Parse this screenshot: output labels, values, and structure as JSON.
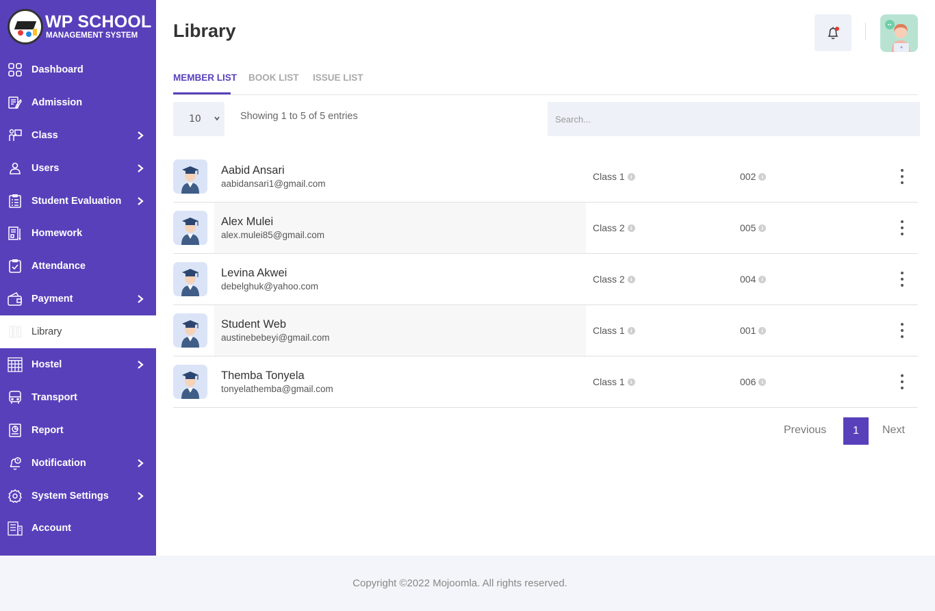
{
  "brand": {
    "title": "WP SCHOOL",
    "subtitle": "MANAGEMENT SYSTEM"
  },
  "sidebar": {
    "items": [
      {
        "label": "Dashboard",
        "icon": "dashboard-grid-icon",
        "has_submenu": false
      },
      {
        "label": "Admission",
        "icon": "admission-form-icon",
        "has_submenu": false
      },
      {
        "label": "Class",
        "icon": "class-teacher-icon",
        "has_submenu": true
      },
      {
        "label": "Users",
        "icon": "user-icon",
        "has_submenu": true
      },
      {
        "label": "Student Evaluation",
        "icon": "clipboard-checklist-icon",
        "has_submenu": true
      },
      {
        "label": "Homework",
        "icon": "homework-book-icon",
        "has_submenu": false
      },
      {
        "label": "Attendance",
        "icon": "attendance-check-icon",
        "has_submenu": false
      },
      {
        "label": "Payment",
        "icon": "wallet-icon",
        "has_submenu": true
      },
      {
        "label": "Library",
        "icon": "library-icon",
        "has_submenu": false,
        "active": true
      },
      {
        "label": "Hostel",
        "icon": "hostel-building-icon",
        "has_submenu": true
      },
      {
        "label": "Transport",
        "icon": "bus-icon",
        "has_submenu": false
      },
      {
        "label": "Report",
        "icon": "report-icon",
        "has_submenu": false
      },
      {
        "label": "Notification",
        "icon": "notification-bell-icon",
        "has_submenu": true
      },
      {
        "label": "System Settings",
        "icon": "gear-icon",
        "has_submenu": true
      },
      {
        "label": "Account",
        "icon": "account-building-icon",
        "has_submenu": false
      }
    ]
  },
  "header": {
    "title": "Library"
  },
  "tabs": [
    {
      "label": "MEMBER LIST",
      "active": true
    },
    {
      "label": "BOOK LIST",
      "active": false
    },
    {
      "label": "ISSUE LIST",
      "active": false
    }
  ],
  "controls": {
    "page_size": "10",
    "entries_text": "Showing 1 to 5 of 5 entries",
    "search_placeholder": "Search..."
  },
  "members": [
    {
      "name": "Aabid Ansari",
      "email": "aabidansari1@gmail.com",
      "class": "Class 1",
      "roll": "002"
    },
    {
      "name": "Alex Mulei",
      "email": "alex.mulei85@gmail.com",
      "class": "Class 2",
      "roll": "005"
    },
    {
      "name": "Levina Akwei",
      "email": "debelghuk@yahoo.com",
      "class": "Class 2",
      "roll": "004"
    },
    {
      "name": "Student Web",
      "email": "austinebebeyi@gmail.com",
      "class": "Class 1",
      "roll": "001"
    },
    {
      "name": "Themba Tonyela",
      "email": "tonyelathemba@gmail.com",
      "class": "Class 1",
      "roll": "006"
    }
  ],
  "pagination": {
    "previous": "Previous",
    "current": "1",
    "next": "Next"
  },
  "footer": {
    "copyright": "Copyright ©2022 Mojoomla. All rights reserved."
  },
  "colors": {
    "accent": "#5840bb",
    "panel": "#eef1f8"
  }
}
